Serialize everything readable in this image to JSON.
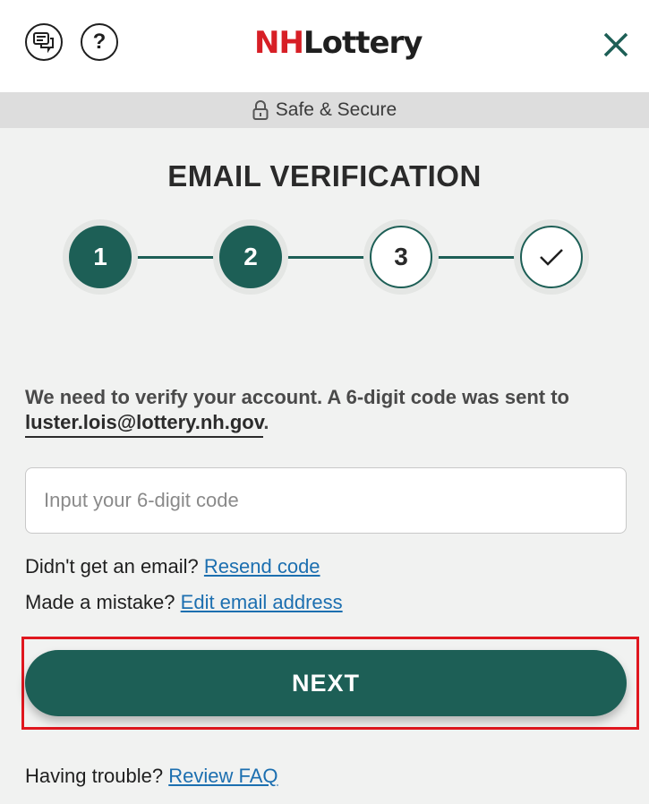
{
  "header": {
    "logo_prefix": "NH",
    "logo_suffix": "Lottery",
    "help_symbol": "?",
    "icons": [
      "chat-icon",
      "help-icon",
      "close-icon"
    ]
  },
  "secure_bar": {
    "label": "Safe & Secure",
    "icon": "lock-icon"
  },
  "page": {
    "title": "EMAIL VERIFICATION"
  },
  "steps": [
    {
      "label": "1",
      "status": "complete"
    },
    {
      "label": "2",
      "status": "complete"
    },
    {
      "label": "3",
      "status": "pending"
    },
    {
      "label": "",
      "status": "pending",
      "icon": "check-icon"
    }
  ],
  "verification": {
    "message_prefix": "We need to verify your account. A 6-digit code was sent to ",
    "email": "luster.lois@lottery.nh.gov",
    "message_suffix": "."
  },
  "code_input": {
    "placeholder": "Input your 6-digit code",
    "value": ""
  },
  "resend": {
    "prompt": "Didn't get an email?",
    "link": "Resend code"
  },
  "edit": {
    "prompt": "Made a mistake?",
    "link": "Edit email address"
  },
  "next_button": {
    "label": "NEXT"
  },
  "help": {
    "prompt": "Having trouble?",
    "link": "Review FAQ"
  },
  "colors": {
    "brand_green": "#1d5f56",
    "brand_red": "#d71f26",
    "link_blue": "#1c6fb0",
    "highlight_red": "#e0171f"
  }
}
